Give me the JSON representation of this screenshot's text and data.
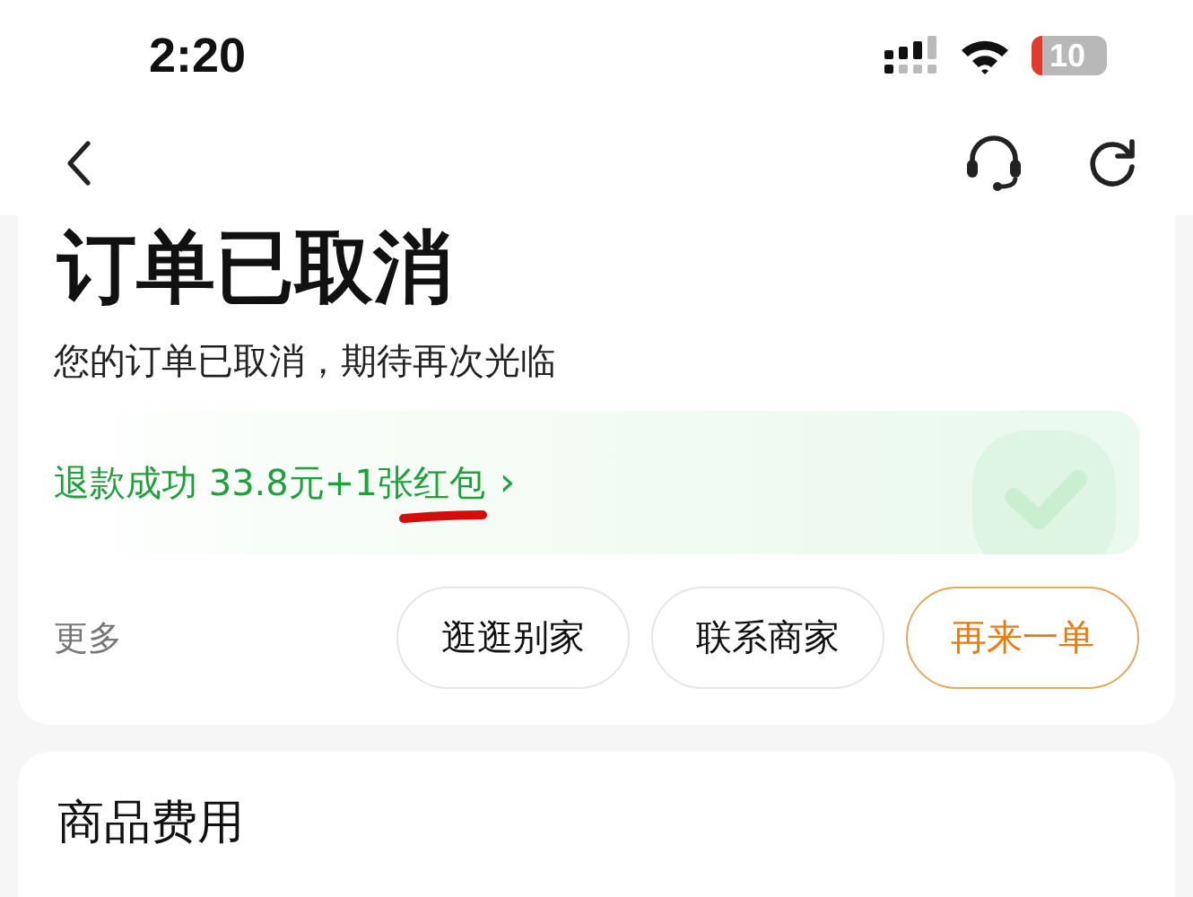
{
  "status_bar": {
    "time": "2:20",
    "battery": "10"
  },
  "order": {
    "title": "订单已取消",
    "subtitle": "您的订单已取消，期待再次光临",
    "refund": {
      "text": "退款成功 33.8元+1张红包",
      "chevron": "›"
    },
    "more": "更多",
    "buttons": [
      {
        "label": "逛逛别家",
        "kind": "secondary"
      },
      {
        "label": "联系商家",
        "kind": "secondary"
      },
      {
        "label": "再来一单",
        "kind": "primary"
      }
    ]
  },
  "fees": {
    "title": "商品费用"
  }
}
